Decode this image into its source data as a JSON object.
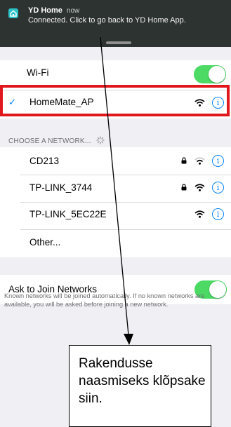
{
  "notification": {
    "app_name": "YD Home",
    "time": "now",
    "message": "Connected. Click to go back to YD Home App."
  },
  "wifi": {
    "label": "Wi-Fi",
    "enabled": true
  },
  "current_network": {
    "checkmark": "✓",
    "name": "HomeMate_AP"
  },
  "networks_header": "CHOOSE A NETWORK...",
  "networks": [
    {
      "name": "CD213",
      "secured": true
    },
    {
      "name": "TP-LINK_3744",
      "secured": true
    },
    {
      "name": "TP-LINK_5EC22E",
      "secured": false
    }
  ],
  "other_label": "Other...",
  "ask_to_join": {
    "label": "Ask to Join Networks",
    "enabled": true,
    "footnote": "Known networks will be joined automatically. If no known networks are available, you will be asked before joining a new network."
  },
  "info_glyph": "i",
  "callout_text": "Rakendusse naasmiseks klõpsake siin.",
  "colors": {
    "accent": "#0a84ff",
    "toggle_on": "#4cd964",
    "highlight": "#e0171b",
    "banner_bg": "#2d3331"
  }
}
